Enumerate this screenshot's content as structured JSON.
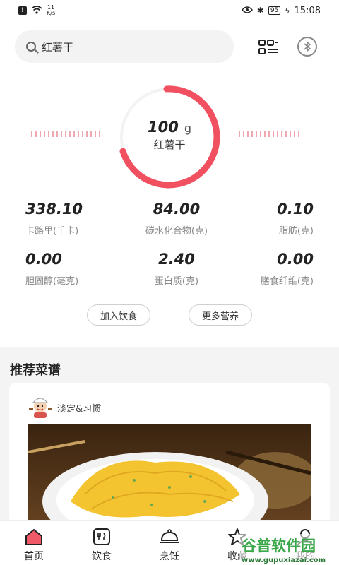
{
  "status_bar": {
    "network_speed_value": "11",
    "network_speed_unit": "K/s",
    "battery": "95",
    "time": "15:08"
  },
  "search": {
    "value": "红薯干"
  },
  "gauge": {
    "weight_value": "100",
    "weight_unit": "g",
    "food_name": "红薯干",
    "accent_color": "#f0505f"
  },
  "nutrients": [
    {
      "value": "338.10",
      "label": "卡路里(千卡)"
    },
    {
      "value": "84.00",
      "label": "碳水化合物(克)"
    },
    {
      "value": "0.10",
      "label": "脂肪(克)"
    },
    {
      "value": "0.00",
      "label": "胆固醇(毫克)"
    },
    {
      "value": "2.40",
      "label": "蛋白质(克)"
    },
    {
      "value": "0.00",
      "label": "膳食纤维(克)"
    }
  ],
  "actions": {
    "add_label": "加入饮食",
    "more_label": "更多营养"
  },
  "recommended": {
    "title": "推荐菜谱",
    "author": "淡定&习惯"
  },
  "bottom_nav": [
    {
      "label": "首页",
      "icon": "home-icon"
    },
    {
      "label": "饮食",
      "icon": "diet-icon"
    },
    {
      "label": "烹饪",
      "icon": "cooking-icon"
    },
    {
      "label": "收藏",
      "icon": "favorite-icon"
    },
    {
      "label": "我的",
      "icon": "profile-icon"
    }
  ],
  "watermark": {
    "brand": "谷普软件园",
    "url": "www.gupuxiazai.com"
  }
}
